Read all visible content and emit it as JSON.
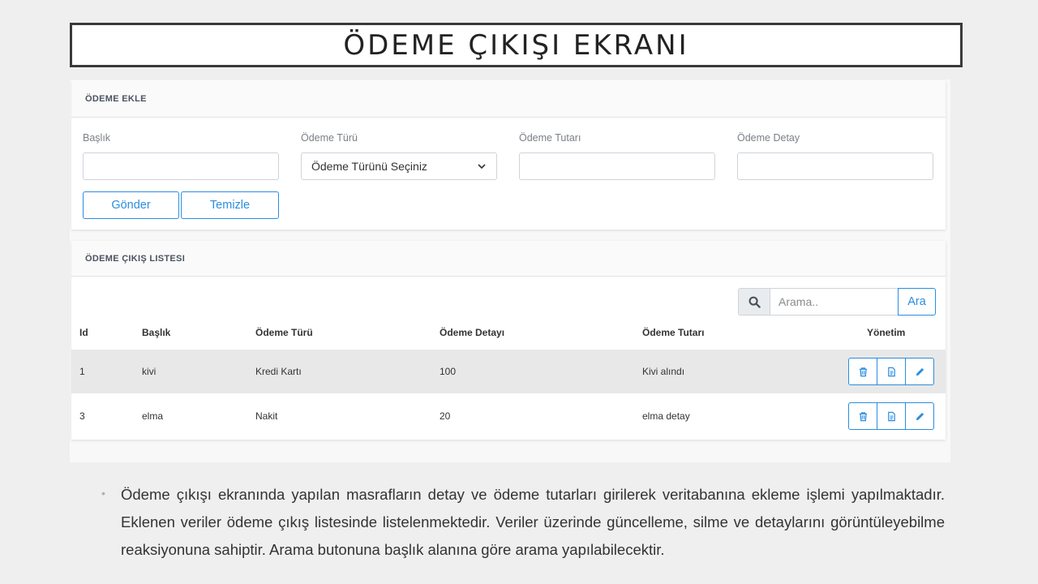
{
  "slide_title": "ÖDEME ÇIKIŞI EKRANI",
  "form": {
    "header": "ÖDEME EKLE",
    "fields": [
      {
        "label": "Başlık",
        "value": ""
      },
      {
        "label": "Ödeme Türü",
        "selected": "Ödeme Türünü Seçiniz"
      },
      {
        "label": "Ödeme Tutarı",
        "value": ""
      },
      {
        "label": "Ödeme Detay",
        "value": ""
      }
    ],
    "submit_label": "Gönder",
    "clear_label": "Temizle"
  },
  "list": {
    "header": "ÖDEME ÇIKIŞ LISTESI",
    "search_placeholder": "Arama..",
    "search_button": "Ara",
    "columns": [
      "Id",
      "Başlık",
      "Ödeme Türü",
      "Ödeme Detayı",
      "Ödeme Tutarı",
      "Yönetim"
    ],
    "rows": [
      {
        "id": "1",
        "title": "kivi",
        "type": "Kredi Kartı",
        "detail": "100",
        "amount": "Kivi alındı"
      },
      {
        "id": "3",
        "title": "elma",
        "type": "Nakit",
        "detail": "20",
        "amount": "elma detay"
      }
    ],
    "action_icons": [
      "trash-icon",
      "document-icon",
      "pencil-icon"
    ]
  },
  "description": "Ödeme çıkışı ekranında yapılan masrafların detay ve ödeme tutarları girilerek  veritabanına ekleme işlemi yapılmaktadır. Eklenen veriler ödeme çıkış listesinde listelenmektedir. Veriler üzerinde güncelleme, silme ve detaylarını görüntüleyebilme reaksiyonuna sahiptir. Arama butonuna başlık alanına göre arama yapılabilecektir.",
  "colors": {
    "accent": "#2a8de0",
    "row_highlight": "#e8e8e8",
    "header_text": "#4a5360"
  }
}
